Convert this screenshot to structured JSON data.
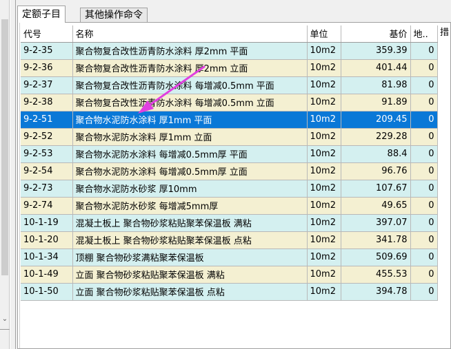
{
  "tabs": [
    {
      "label": "定额子目",
      "active": true
    },
    {
      "label": "其他操作命令",
      "active": false
    }
  ],
  "table": {
    "columns": [
      "代号",
      "名称",
      "单位",
      "基价",
      "地..",
      "措"
    ],
    "rows": [
      {
        "code": "9-2-35",
        "name": "聚合物复合改性沥青防水涂料 厚2mm 平面",
        "unit": "10m2",
        "price": "359.39",
        "qty": "0"
      },
      {
        "code": "9-2-36",
        "name": "聚合物复合改性沥青防水涂料 厚2mm 立面",
        "unit": "10m2",
        "price": "401.44",
        "qty": "0"
      },
      {
        "code": "9-2-37",
        "name": "聚合物复合改性沥青防水涂料 每增减0.5mm 平面",
        "unit": "10m2",
        "price": "81.98",
        "qty": "0"
      },
      {
        "code": "9-2-38",
        "name": "聚合物复合改性沥青防水涂料 每增减0.5mm 立面",
        "unit": "10m2",
        "price": "91.89",
        "qty": "0"
      },
      {
        "code": "9-2-51",
        "name": "聚合物水泥防水涂料 厚1mm 平面",
        "unit": "10m2",
        "price": "209.45",
        "qty": "0"
      },
      {
        "code": "9-2-52",
        "name": "聚合物水泥防水涂料 厚1mm 立面",
        "unit": "10m2",
        "price": "229.28",
        "qty": "0"
      },
      {
        "code": "9-2-53",
        "name": "聚合物水泥防水涂料 每增减0.5mm厚 平面",
        "unit": "10m2",
        "price": "88.4",
        "qty": "0"
      },
      {
        "code": "9-2-54",
        "name": "聚合物水泥防水涂料 每增减0.5mm厚 立面",
        "unit": "10m2",
        "price": "96.76",
        "qty": "0"
      },
      {
        "code": "9-2-73",
        "name": "聚合物水泥防水砂浆 厚10mm",
        "unit": "10m2",
        "price": "107.67",
        "qty": "0"
      },
      {
        "code": "9-2-74",
        "name": "聚合物水泥防水砂浆 每增减5mm厚",
        "unit": "10m2",
        "price": "49.65",
        "qty": "0"
      },
      {
        "code": "10-1-19",
        "name": "混凝土板上 聚合物砂浆粘贴聚苯保温板 满粘",
        "unit": "10m2",
        "price": "397.07",
        "qty": "0"
      },
      {
        "code": "10-1-20",
        "name": "混凝土板上 聚合物砂浆粘贴聚苯保温板 点粘",
        "unit": "10m2",
        "price": "341.78",
        "qty": "0"
      },
      {
        "code": "10-1-34",
        "name": "顶棚 聚合物砂浆满粘聚苯保温板",
        "unit": "10m2",
        "price": "509.69",
        "qty": "0"
      },
      {
        "code": "10-1-49",
        "name": "立面 聚合物砂浆粘贴聚苯保温板 满粘",
        "unit": "10m2",
        "price": "455.53",
        "qty": "0"
      },
      {
        "code": "10-1-50",
        "name": "立面 聚合物砂浆粘贴聚苯保温板 点粘",
        "unit": "10m2",
        "price": "394.78",
        "qty": "0"
      }
    ],
    "selected_row": 4
  },
  "colors": {
    "row_cyan": "#d4f0f0",
    "row_beige": "#f4f0d2",
    "selected": "#0a78d7",
    "annotation_arrow": "#e040e0"
  },
  "icons": {
    "scroll_down": "chevron-down-icon",
    "annotation": "arrow-annotation-icon"
  }
}
